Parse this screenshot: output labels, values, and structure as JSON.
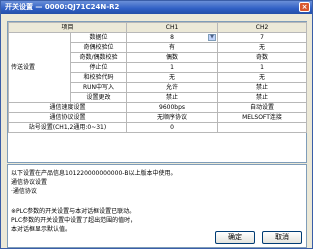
{
  "window": {
    "title": "开关设置 — 0000:QJ71C24N-R2",
    "close": "×"
  },
  "table": {
    "header": {
      "item": "项目",
      "ch1": "CH1",
      "ch2": "CH2"
    },
    "transfer_group": "传送设置",
    "transfer_rows": [
      {
        "label": "数据位",
        "ch1": "8",
        "ch2": "7"
      },
      {
        "label": "奇偶校验位",
        "ch1": "有",
        "ch2": "无"
      },
      {
        "label": "奇数/偶数校验",
        "ch1": "偶数",
        "ch2": "奇数"
      },
      {
        "label": "停止位",
        "ch1": "1",
        "ch2": "1"
      },
      {
        "label": "和校验代码",
        "ch1": "无",
        "ch2": "无"
      },
      {
        "label": "RUN中写入",
        "ch1": "允许",
        "ch2": "禁止"
      },
      {
        "label": "设置更改",
        "ch1": "禁止",
        "ch2": "禁止"
      }
    ],
    "other_rows": [
      {
        "label": "通信速度设置",
        "ch1": "9600bps",
        "ch2": "自动设置"
      },
      {
        "label": "通信协议设置",
        "ch1": "无顺序协议",
        "ch2": "MELSOFT连接"
      },
      {
        "label": "站号设置(CH1,2通用:0~31)",
        "ch1": "0",
        "ch2": ""
      }
    ]
  },
  "info": {
    "line1": "以下设置在产品信息101220000000000-B以上版本中使用。",
    "line2": "通信协议设置",
    "line3": "·通信协议",
    "line4": "※PLC参数的开关设置与本对话框设置已联动。",
    "line5": "  PLC参数的开关设置中设置了超出范围的值时，",
    "line6": "  本对话框显示默认值。"
  },
  "buttons": {
    "ok": "确定",
    "cancel": "取消"
  }
}
